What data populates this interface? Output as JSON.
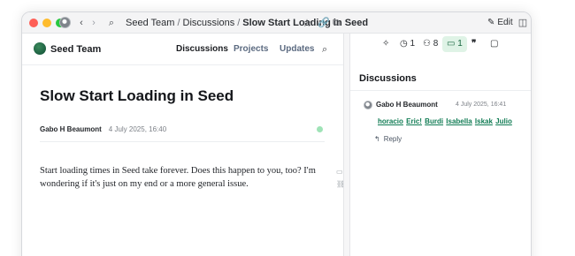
{
  "titlebar": {
    "back_icon": "‹",
    "forward_icon": "›",
    "search_icon": "⌕",
    "breadcrumb": [
      "Seed Team",
      "Discussions",
      "Slow Start Loading in Seed"
    ],
    "breadcrumb_separator": "/",
    "star_icon": "☆",
    "link_icon": "🔗",
    "copy_icon": "⧉",
    "edit_icon": "✎",
    "edit_label": "Edit",
    "panel_toggle_icon": "◫"
  },
  "site": {
    "name": "Seed Team",
    "nav": [
      "Discussions",
      "Projects",
      "Updates"
    ],
    "search_icon": "⌕"
  },
  "document": {
    "title": "Slow Start Loading in Seed",
    "author": "Gabo H Beaumont",
    "date": "4 July 2025, 16:40",
    "body": "Start loading times in Seed take forever. Does this happen to you, too? I'm wondering if it's just on my end or a more general issue.",
    "side_comment_icon": "▭",
    "side_link_icon": "⛓"
  },
  "panel": {
    "tools": {
      "spark_icon": "✧",
      "clock_icon": "◷",
      "versions_count": "1",
      "users_icon": "⚇",
      "collaborators_count": "8",
      "comments_icon": "▭",
      "comments_count": "1",
      "quote_icon": "❞",
      "folder_icon": "▢"
    },
    "title": "Discussions",
    "comment": {
      "author": "Gabo H Beaumont",
      "date": "4 July 2025, 16:41",
      "mentions": [
        "horacio",
        "Eric!",
        "Burdi",
        "Isabella",
        "Iskak",
        "Julio"
      ],
      "reply_icon": "↰",
      "reply_label": "Reply"
    }
  },
  "colors": {
    "accent_green": "#0f7b53",
    "active_tab_bg": "#dff3e6",
    "status_dot": "#9fe3b7",
    "nav_muted": "#5b6a80"
  }
}
